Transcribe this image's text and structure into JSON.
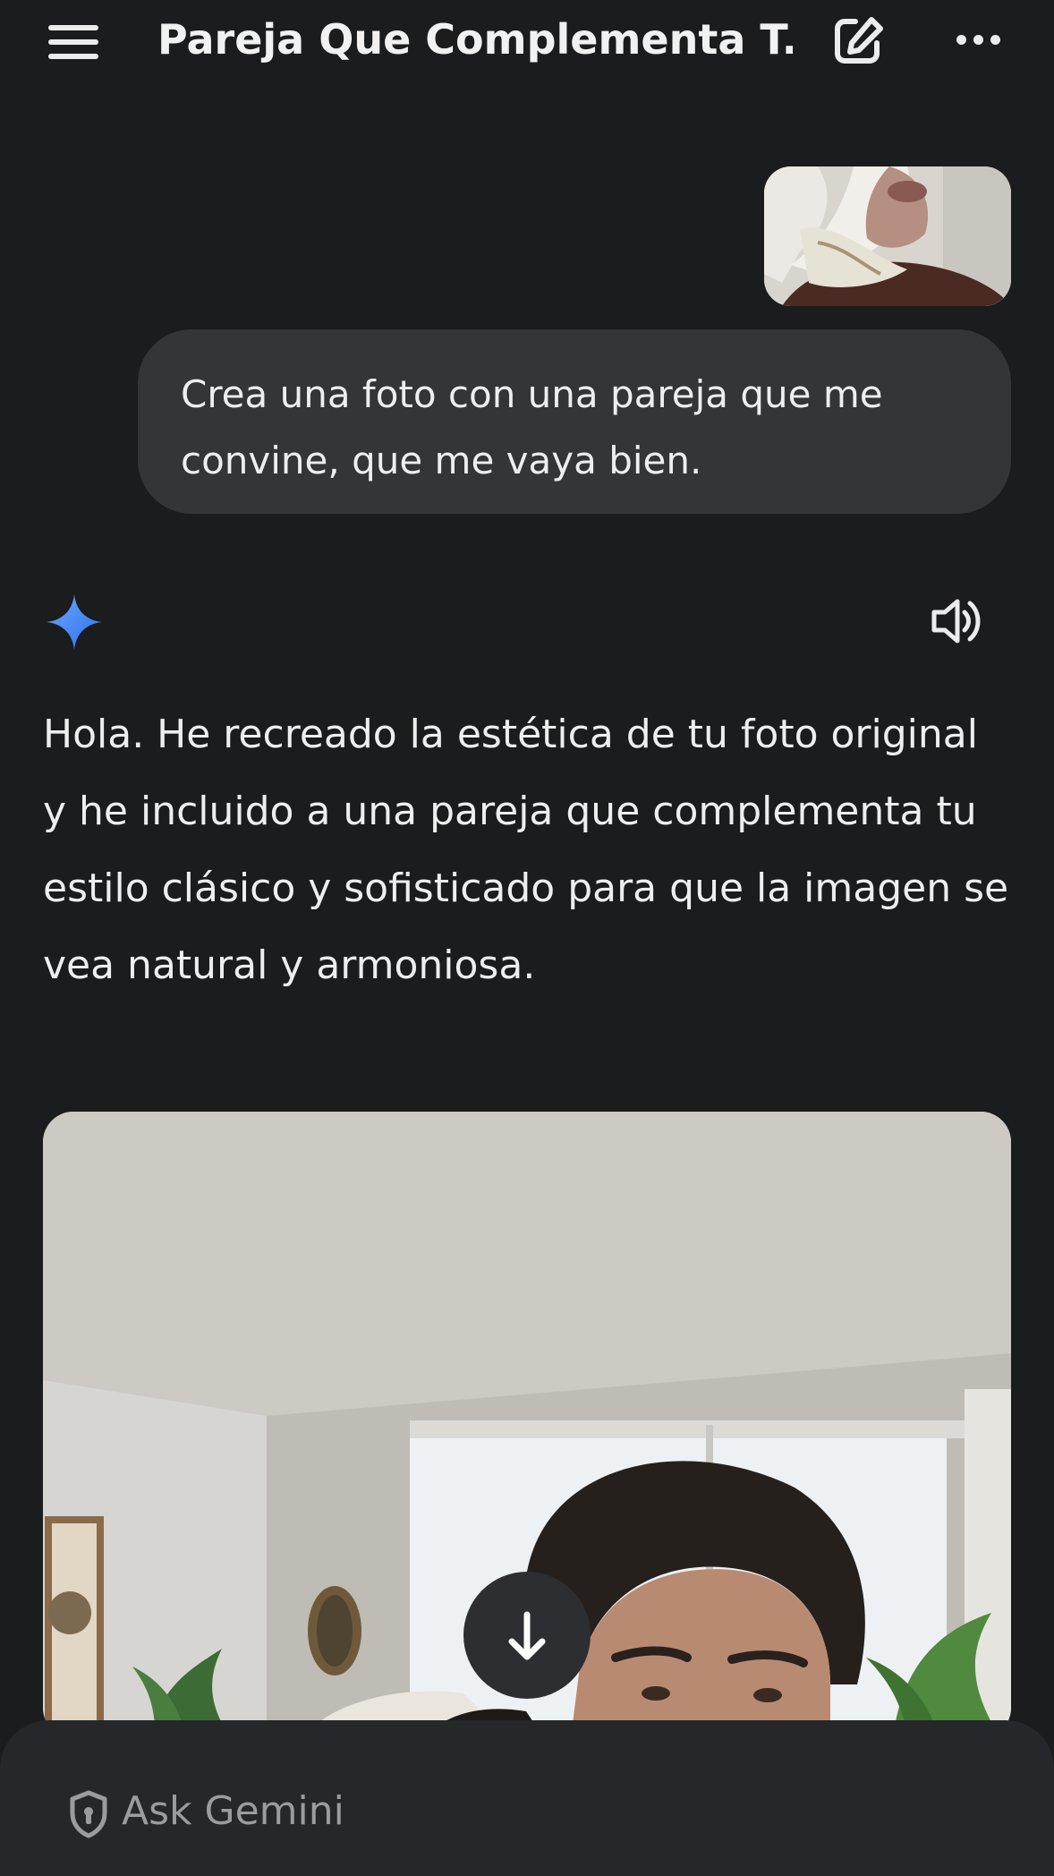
{
  "header": {
    "title": "Pareja Que Complementa T..."
  },
  "icons": {
    "menu": "hamburger-menu-icon",
    "edit": "edit-chat-icon",
    "more": "more-options-icon",
    "assistant": "gemini-sparkle-icon",
    "speaker": "speaker-icon",
    "scroll": "arrow-down-icon",
    "shield": "shield-icon"
  },
  "conversation": {
    "user_message": "Crea una foto con una pareja que me convine, que me vaya bien.",
    "assistant_reply": "Hola. He recreado la estética de tu foto original y he incluido a una pareja que complementa tu estilo clásico y sofisticado para que la imagen se vea natural y armoniosa."
  },
  "composer": {
    "placeholder": "Ask Gemini"
  },
  "colors": {
    "background": "#1b1c1e",
    "bubble": "#333537",
    "text": "#eeeeee",
    "gemini_blue": "#4a8cff"
  }
}
